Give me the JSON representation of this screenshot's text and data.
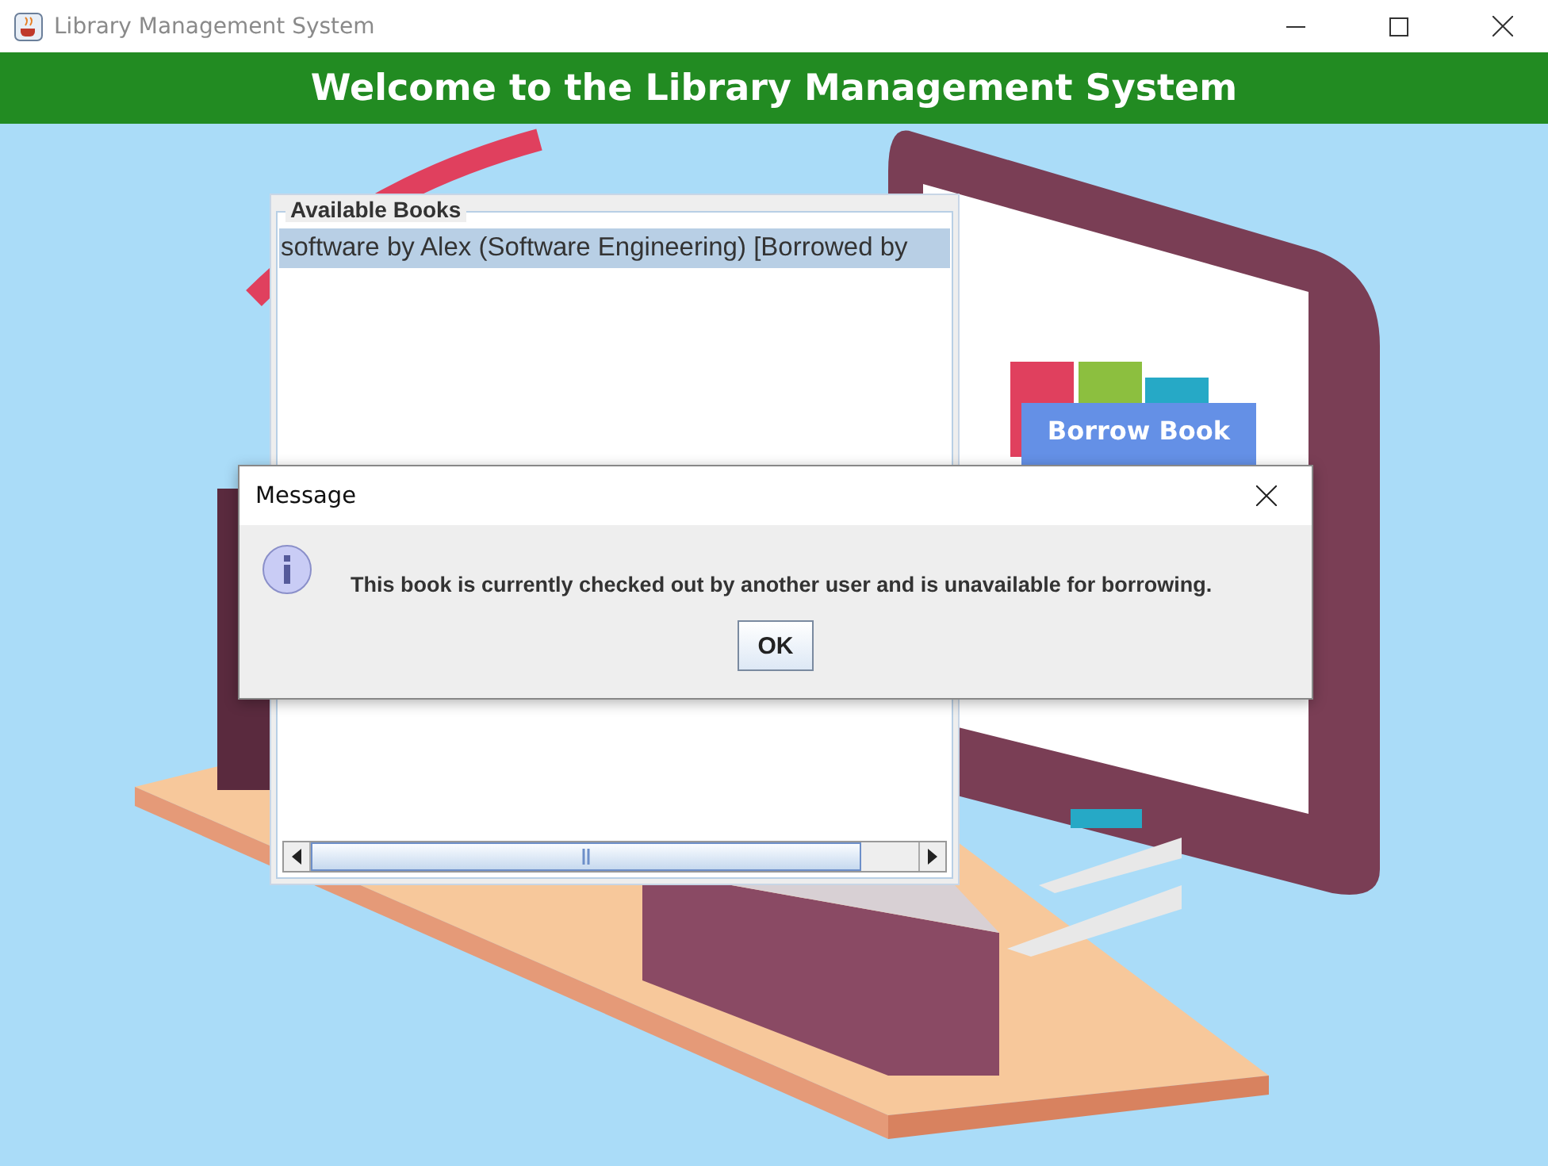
{
  "window": {
    "title": "Library Management System"
  },
  "header": {
    "title": "Welcome to the Library Management System"
  },
  "books_panel": {
    "title": "Available Books",
    "items": [
      {
        "label": "software by Alex (Software Engineering) [Borrowed by",
        "selected": true
      }
    ]
  },
  "borrow_button": {
    "label": "Borrow Book"
  },
  "dialog": {
    "title": "Message",
    "message": "This book is currently checked out by another user and is unavailable for borrowing.",
    "buttons": [
      "OK"
    ]
  }
}
